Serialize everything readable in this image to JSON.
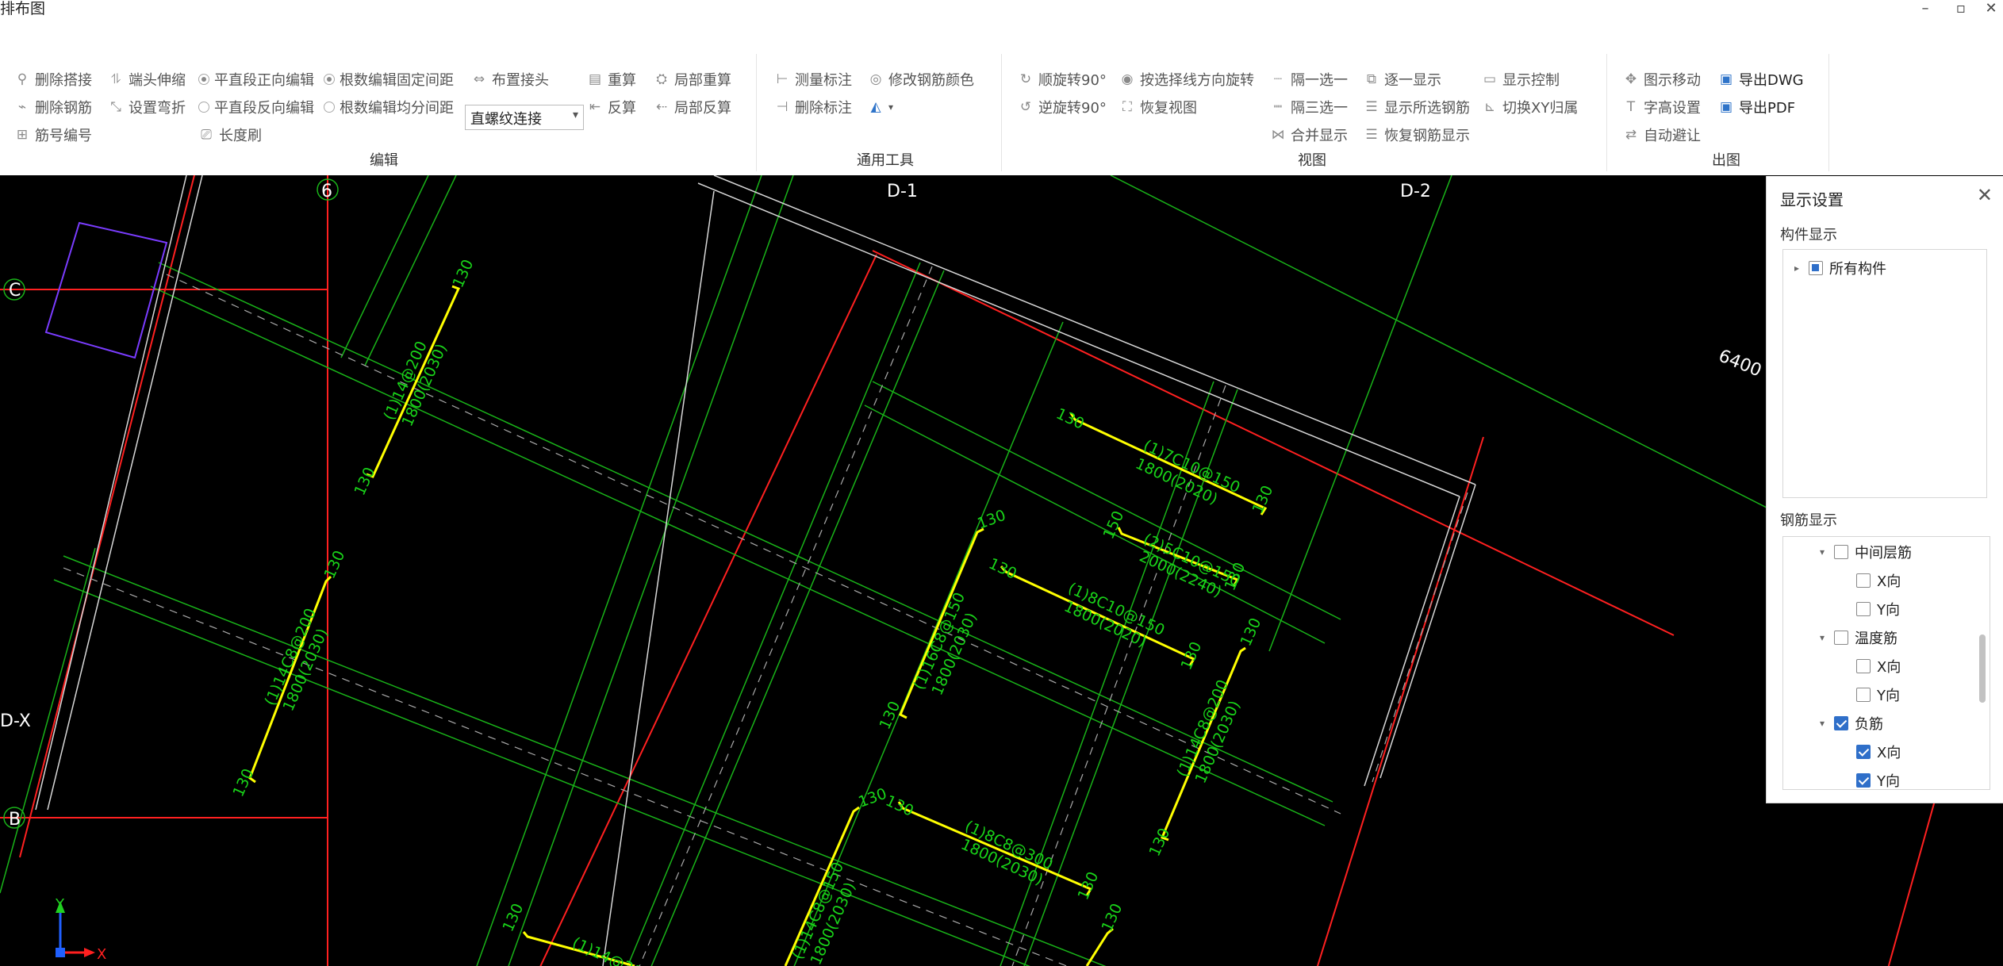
{
  "window": {
    "title": "排布图",
    "minimize": "–",
    "maximize": "▫",
    "close": "✕"
  },
  "ribbon": {
    "edit": {
      "label": "编辑",
      "delete_lap": "删除搭接",
      "end_stretch": "端头伸缩",
      "flat_forward_edit": "平直段正向编辑",
      "count_fixed_spacing": "根数编辑固定间距",
      "place_joint": "布置接头",
      "recalc": "重算",
      "local_recalc": "局部重算",
      "delete_rebar": "删除钢筋",
      "set_bend": "设置弯折",
      "flat_reverse_edit": "平直段反向编辑",
      "count_even_spacing": "根数编辑均分间距",
      "connection_type": "直螺纹连接",
      "reverse_calc": "反算",
      "local_reverse_calc": "局部反算",
      "bar_number": "筋号编号",
      "length_brush": "长度刷"
    },
    "tools": {
      "label": "通用工具",
      "measure_dim": "测量标注",
      "change_color": "修改钢筋颜色",
      "delete_dim": "删除标注"
    },
    "view": {
      "label": "视图",
      "rotate_cw": "顺旋转90°",
      "rotate_by_line": "按选择线方向旋转",
      "every_other": "隔一选一",
      "one_by_one": "逐一显示",
      "display_control": "显示控制",
      "rotate_ccw": "逆旋转90°",
      "restore_view": "恢复视图",
      "every_third": "隔三选一",
      "show_selected": "显示所选钢筋",
      "switch_xy": "切换XY归属",
      "merge_show": "合并显示",
      "restore_rebar": "恢复钢筋显示"
    },
    "output": {
      "label": "出图",
      "move_drawing": "图示移动",
      "export_dwg": "导出DWG",
      "text_height": "字高设置",
      "export_pdf": "导出PDF",
      "auto_avoid": "自动避让"
    }
  },
  "canvas": {
    "axes": {
      "c": "C",
      "b": "B",
      "dx": "D-X",
      "six": "6",
      "d1": "D-1",
      "d2": "D-2"
    },
    "dimension": "6400",
    "ucs": {
      "x": "X",
      "y": "Y"
    },
    "rebar_labels": {
      "r1a": "(1)14@200",
      "r1b": "1800(2030)",
      "r2a": "(1)7C10@150",
      "r2b": "1800(2020)",
      "r3a": "(2)5C10@150",
      "r3b": "2000(2240)",
      "r4a": "(1)16C8@150",
      "r4b": "1800(2030)",
      "r5a": "(1)8C10@150",
      "r5b": "1800(2020)",
      "r6a": "(1)14C8@200",
      "r6b": "1800(2030)",
      "r7a": "(1)14C8@200",
      "r7b": "1800(2030)",
      "r8a": "(1)8C8@300",
      "r8b": "1800(2030)",
      "r9a": "(1)14C8@150",
      "r9b": "1800(2030)",
      "r10a": "(1)14@200"
    },
    "hook": "130",
    "hook150": "150"
  },
  "panel": {
    "title": "显示设置",
    "component_section": "构件显示",
    "all_components": "所有构件",
    "rebar_section": "钢筋显示",
    "items": {
      "middle_layer": "中间层筋",
      "x_dir": "X向",
      "y_dir": "Y向",
      "temperature": "温度筋",
      "negative": "负筋"
    }
  },
  "colors": {
    "canvas_bg": "#000000",
    "rebar": "#ffff00",
    "text": "#00ff00",
    "axis": "#ff2020"
  }
}
